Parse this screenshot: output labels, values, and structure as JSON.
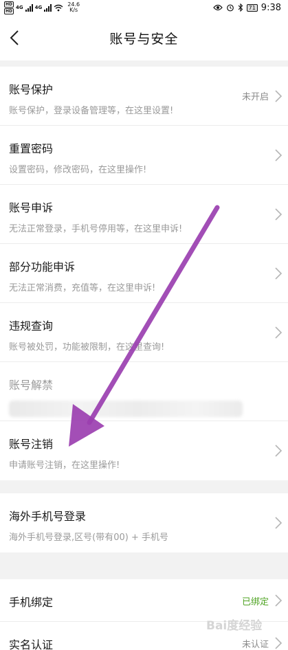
{
  "status_bar": {
    "hd1": "HD",
    "hd2": "HD",
    "net1": "4G",
    "net2": "4G",
    "speed_value": "24.6",
    "speed_unit": "K/s",
    "battery": "71",
    "time": "9:38"
  },
  "header": {
    "title": "账号与安全"
  },
  "group1": [
    {
      "title": "账号保护",
      "desc": "账号保护，登录设备管理等，在这里设置!",
      "status": "未开启"
    },
    {
      "title": "重置密码",
      "desc": "设置密码，修改密码，在这里操作!"
    },
    {
      "title": "账号申诉",
      "desc": "无法正常登录，手机号停用等，在这里申诉!"
    },
    {
      "title": "部分功能申诉",
      "desc": "无法正常消费，充值等，在这里申诉!"
    },
    {
      "title": "违规查询",
      "desc": "账号被处罚，功能被限制，在这里查询!"
    },
    {
      "title": "账号解禁"
    },
    {
      "title": "账号注销",
      "desc": "申请账号注销，在这里操作!"
    }
  ],
  "group2": [
    {
      "title": "海外手机号登录",
      "desc": "海外手机号登录,区号(带有00) + 手机号"
    }
  ],
  "group3": [
    {
      "title": "手机绑定",
      "status": "已绑定"
    },
    {
      "title": "实名认证",
      "status": "未认证"
    }
  ],
  "colors": {
    "bound_green": "#4fa323",
    "arrow_purple": "#9b3fb0"
  },
  "watermark": "Bai度经验"
}
